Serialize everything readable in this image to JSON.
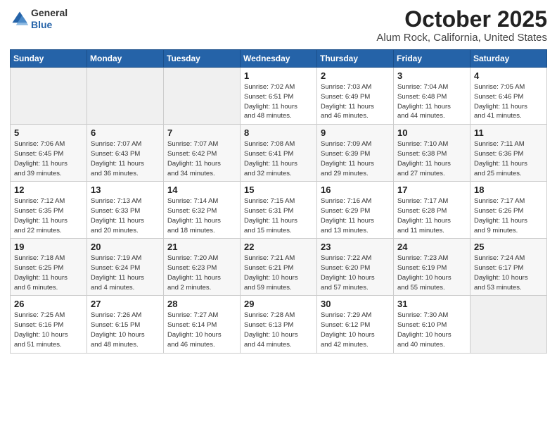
{
  "logo": {
    "general": "General",
    "blue": "Blue"
  },
  "header": {
    "month": "October 2025",
    "location": "Alum Rock, California, United States"
  },
  "weekdays": [
    "Sunday",
    "Monday",
    "Tuesday",
    "Wednesday",
    "Thursday",
    "Friday",
    "Saturday"
  ],
  "weeks": [
    [
      {
        "day": "",
        "info": ""
      },
      {
        "day": "",
        "info": ""
      },
      {
        "day": "",
        "info": ""
      },
      {
        "day": "1",
        "info": "Sunrise: 7:02 AM\nSunset: 6:51 PM\nDaylight: 11 hours\nand 48 minutes."
      },
      {
        "day": "2",
        "info": "Sunrise: 7:03 AM\nSunset: 6:49 PM\nDaylight: 11 hours\nand 46 minutes."
      },
      {
        "day": "3",
        "info": "Sunrise: 7:04 AM\nSunset: 6:48 PM\nDaylight: 11 hours\nand 44 minutes."
      },
      {
        "day": "4",
        "info": "Sunrise: 7:05 AM\nSunset: 6:46 PM\nDaylight: 11 hours\nand 41 minutes."
      }
    ],
    [
      {
        "day": "5",
        "info": "Sunrise: 7:06 AM\nSunset: 6:45 PM\nDaylight: 11 hours\nand 39 minutes."
      },
      {
        "day": "6",
        "info": "Sunrise: 7:07 AM\nSunset: 6:43 PM\nDaylight: 11 hours\nand 36 minutes."
      },
      {
        "day": "7",
        "info": "Sunrise: 7:07 AM\nSunset: 6:42 PM\nDaylight: 11 hours\nand 34 minutes."
      },
      {
        "day": "8",
        "info": "Sunrise: 7:08 AM\nSunset: 6:41 PM\nDaylight: 11 hours\nand 32 minutes."
      },
      {
        "day": "9",
        "info": "Sunrise: 7:09 AM\nSunset: 6:39 PM\nDaylight: 11 hours\nand 29 minutes."
      },
      {
        "day": "10",
        "info": "Sunrise: 7:10 AM\nSunset: 6:38 PM\nDaylight: 11 hours\nand 27 minutes."
      },
      {
        "day": "11",
        "info": "Sunrise: 7:11 AM\nSunset: 6:36 PM\nDaylight: 11 hours\nand 25 minutes."
      }
    ],
    [
      {
        "day": "12",
        "info": "Sunrise: 7:12 AM\nSunset: 6:35 PM\nDaylight: 11 hours\nand 22 minutes."
      },
      {
        "day": "13",
        "info": "Sunrise: 7:13 AM\nSunset: 6:33 PM\nDaylight: 11 hours\nand 20 minutes."
      },
      {
        "day": "14",
        "info": "Sunrise: 7:14 AM\nSunset: 6:32 PM\nDaylight: 11 hours\nand 18 minutes."
      },
      {
        "day": "15",
        "info": "Sunrise: 7:15 AM\nSunset: 6:31 PM\nDaylight: 11 hours\nand 15 minutes."
      },
      {
        "day": "16",
        "info": "Sunrise: 7:16 AM\nSunset: 6:29 PM\nDaylight: 11 hours\nand 13 minutes."
      },
      {
        "day": "17",
        "info": "Sunrise: 7:17 AM\nSunset: 6:28 PM\nDaylight: 11 hours\nand 11 minutes."
      },
      {
        "day": "18",
        "info": "Sunrise: 7:17 AM\nSunset: 6:26 PM\nDaylight: 11 hours\nand 9 minutes."
      }
    ],
    [
      {
        "day": "19",
        "info": "Sunrise: 7:18 AM\nSunset: 6:25 PM\nDaylight: 11 hours\nand 6 minutes."
      },
      {
        "day": "20",
        "info": "Sunrise: 7:19 AM\nSunset: 6:24 PM\nDaylight: 11 hours\nand 4 minutes."
      },
      {
        "day": "21",
        "info": "Sunrise: 7:20 AM\nSunset: 6:23 PM\nDaylight: 11 hours\nand 2 minutes."
      },
      {
        "day": "22",
        "info": "Sunrise: 7:21 AM\nSunset: 6:21 PM\nDaylight: 10 hours\nand 59 minutes."
      },
      {
        "day": "23",
        "info": "Sunrise: 7:22 AM\nSunset: 6:20 PM\nDaylight: 10 hours\nand 57 minutes."
      },
      {
        "day": "24",
        "info": "Sunrise: 7:23 AM\nSunset: 6:19 PM\nDaylight: 10 hours\nand 55 minutes."
      },
      {
        "day": "25",
        "info": "Sunrise: 7:24 AM\nSunset: 6:17 PM\nDaylight: 10 hours\nand 53 minutes."
      }
    ],
    [
      {
        "day": "26",
        "info": "Sunrise: 7:25 AM\nSunset: 6:16 PM\nDaylight: 10 hours\nand 51 minutes."
      },
      {
        "day": "27",
        "info": "Sunrise: 7:26 AM\nSunset: 6:15 PM\nDaylight: 10 hours\nand 48 minutes."
      },
      {
        "day": "28",
        "info": "Sunrise: 7:27 AM\nSunset: 6:14 PM\nDaylight: 10 hours\nand 46 minutes."
      },
      {
        "day": "29",
        "info": "Sunrise: 7:28 AM\nSunset: 6:13 PM\nDaylight: 10 hours\nand 44 minutes."
      },
      {
        "day": "30",
        "info": "Sunrise: 7:29 AM\nSunset: 6:12 PM\nDaylight: 10 hours\nand 42 minutes."
      },
      {
        "day": "31",
        "info": "Sunrise: 7:30 AM\nSunset: 6:10 PM\nDaylight: 10 hours\nand 40 minutes."
      },
      {
        "day": "",
        "info": ""
      }
    ]
  ]
}
